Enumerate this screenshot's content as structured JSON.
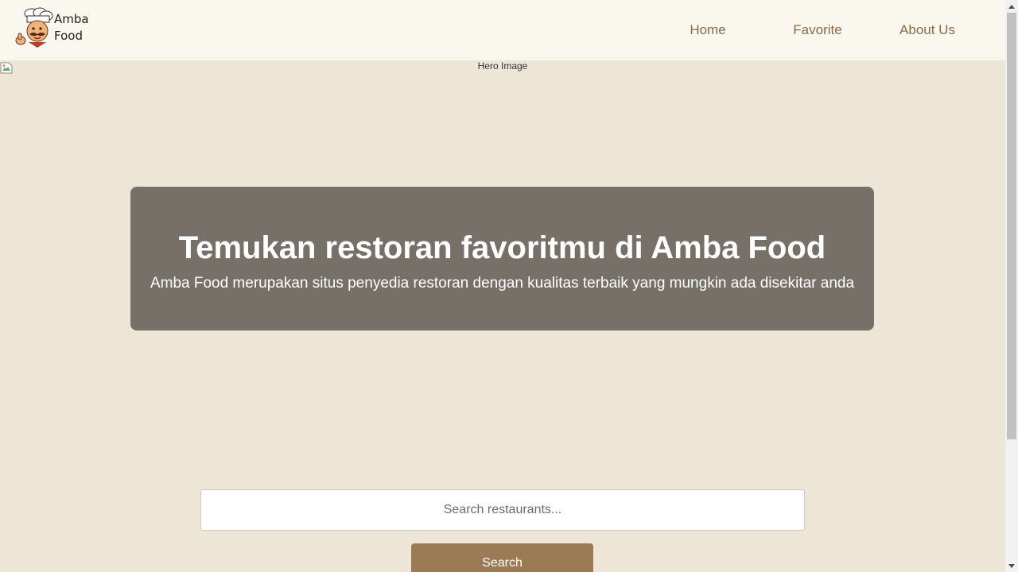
{
  "header": {
    "brand_line1": "Amba",
    "brand_line2": "Food",
    "nav": {
      "home": "Home",
      "favorite": "Favorite",
      "about": "About Us"
    }
  },
  "hero": {
    "image_alt": "Hero Image",
    "title": "Temukan restoran favoritmu di Amba Food",
    "subtitle": "Amba Food merupakan situs penyedia restoran dengan kualitas terbaik yang mungkin ada disekitar anda"
  },
  "search": {
    "placeholder": "Search restaurants...",
    "value": "",
    "button_label": "Search"
  },
  "colors": {
    "page_bg": "#ede5d6",
    "header_bg": "#faf7ef",
    "nav_link": "#8c6a48",
    "hero_card": "#767069",
    "search_button": "#9b7a56"
  },
  "icons": {
    "logo": "chef-mascot-icon",
    "broken_image": "broken-image-icon"
  }
}
